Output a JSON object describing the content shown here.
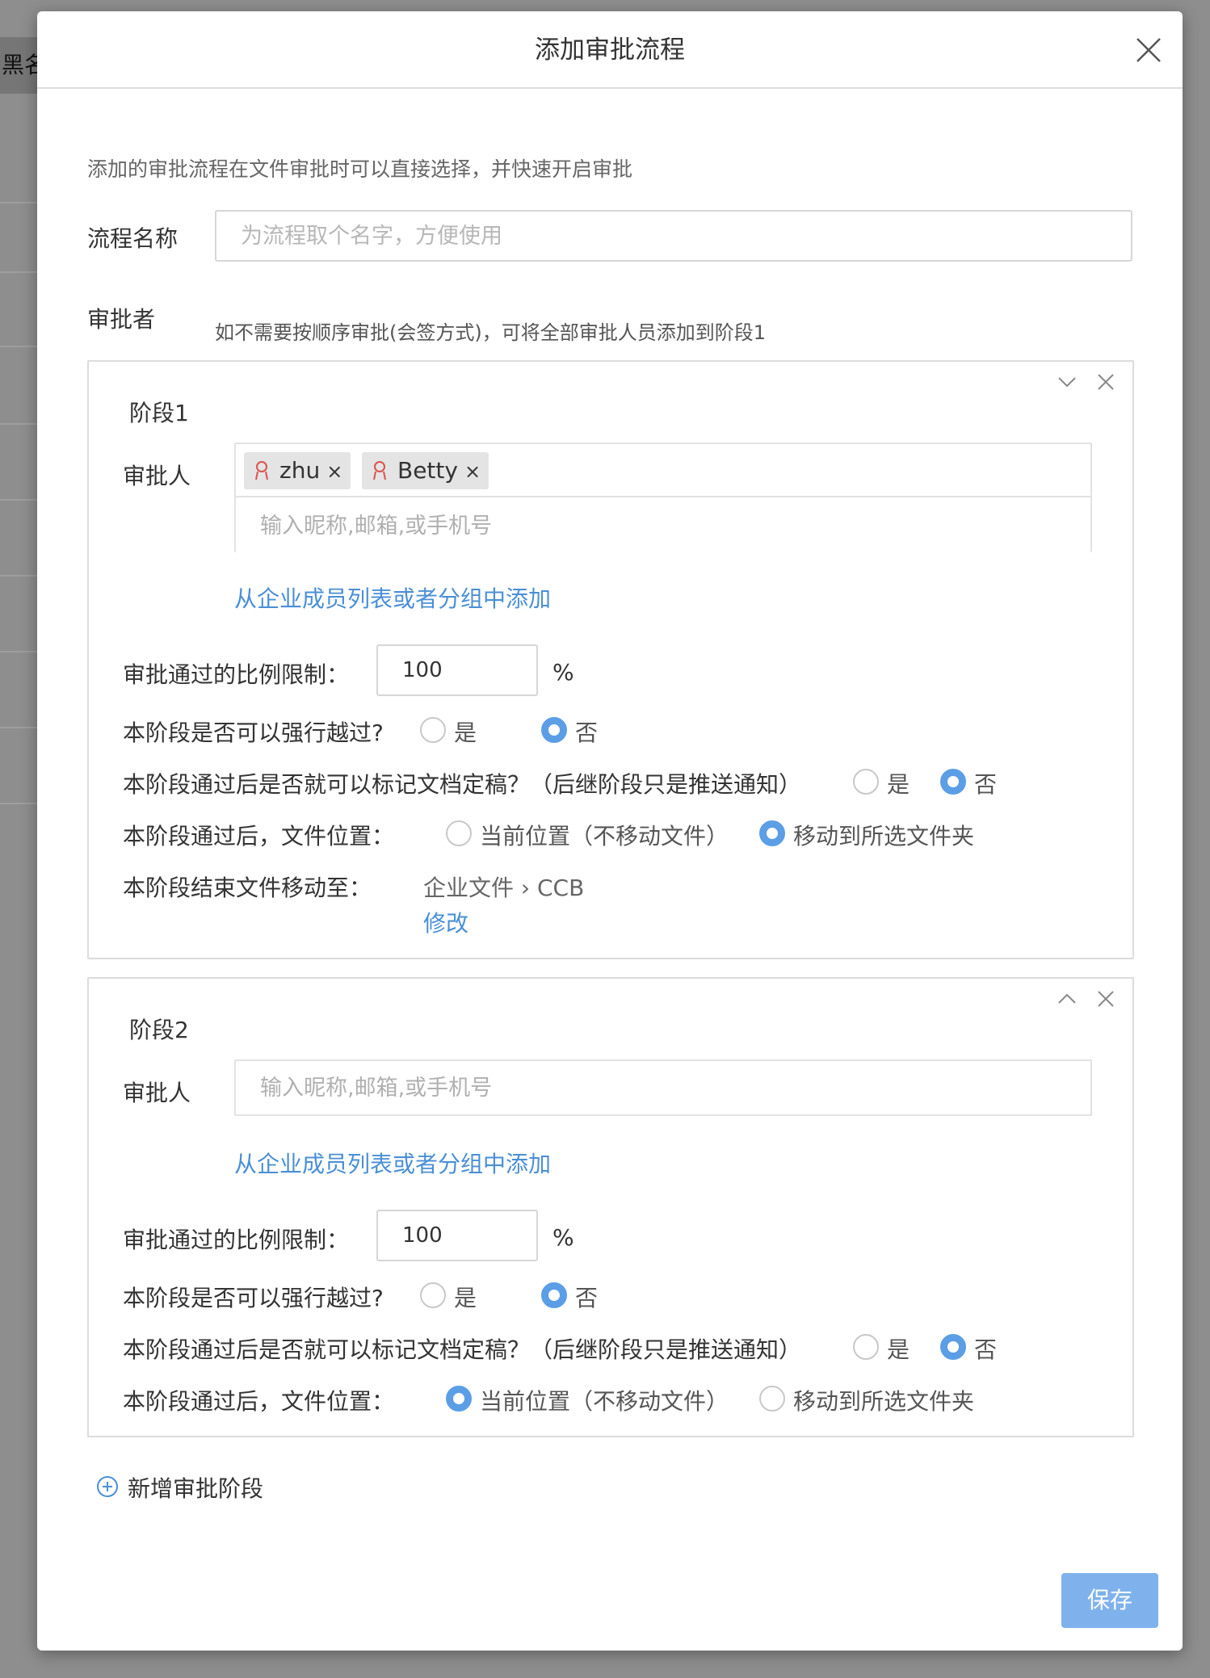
{
  "background": {
    "tab_label": "黑名"
  },
  "dialog": {
    "title": "添加审批流程",
    "description": "添加的审批流程在文件审批时可以直接选择，并快速开启审批",
    "flow_name_label": "流程名称",
    "flow_name_placeholder": "为流程取个名字，方便使用",
    "flow_name_value": "",
    "approvers_label": "审批者",
    "approvers_hint": "如不需要按顺序审批(会签方式)，可将全部审批人员添加到阶段1",
    "stages": [
      {
        "title": "阶段1",
        "approver_label": "审批人",
        "approvers": [
          {
            "name": "zhu",
            "remove": "×"
          },
          {
            "name": "Betty",
            "remove": "×"
          }
        ],
        "approver_placeholder": "输入昵称,邮箱,或手机号",
        "add_from_org": "从企业成员列表或者分组中添加",
        "ratio_label": "审批通过的比例限制：",
        "ratio_value": "100",
        "ratio_unit": "%",
        "skip_label": "本阶段是否可以强行越过?",
        "skip_options": [
          "是",
          "否"
        ],
        "skip_selected": "否",
        "finalize_label": "本阶段通过后是否就可以标记文档定稿？（后继阶段只是推送通知）",
        "finalize_options": [
          "是",
          "否"
        ],
        "finalize_selected": "否",
        "location_label": "本阶段通过后，文件位置：",
        "location_options": [
          "当前位置（不移动文件）",
          "移动到所选文件夹"
        ],
        "location_selected": "移动到所选文件夹",
        "move_to_label": "本阶段结束文件移动至：",
        "move_to_path": "企业文件 › CCB",
        "modify_link": "修改",
        "collapse_icon": "chevron-down-icon"
      },
      {
        "title": "阶段2",
        "approver_label": "审批人",
        "approvers": [],
        "approver_placeholder": "输入昵称,邮箱,或手机号",
        "add_from_org": "从企业成员列表或者分组中添加",
        "ratio_label": "审批通过的比例限制：",
        "ratio_value": "100",
        "ratio_unit": "%",
        "skip_label": "本阶段是否可以强行越过?",
        "skip_options": [
          "是",
          "否"
        ],
        "skip_selected": "否",
        "finalize_label": "本阶段通过后是否就可以标记文档定稿？（后继阶段只是推送通知）",
        "finalize_options": [
          "是",
          "否"
        ],
        "finalize_selected": "否",
        "location_label": "本阶段通过后，文件位置：",
        "location_options": [
          "当前位置（不移动文件）",
          "移动到所选文件夹"
        ],
        "location_selected": "当前位置（不移动文件）",
        "collapse_icon": "chevron-up-icon"
      }
    ],
    "add_stage_label": "新增审批阶段",
    "save_label": "保存"
  },
  "colors": {
    "accent": "#5b9ee6",
    "link": "#4a8fd6",
    "save_button": "#7fb2ec",
    "tag_icon": "#d9534f"
  }
}
